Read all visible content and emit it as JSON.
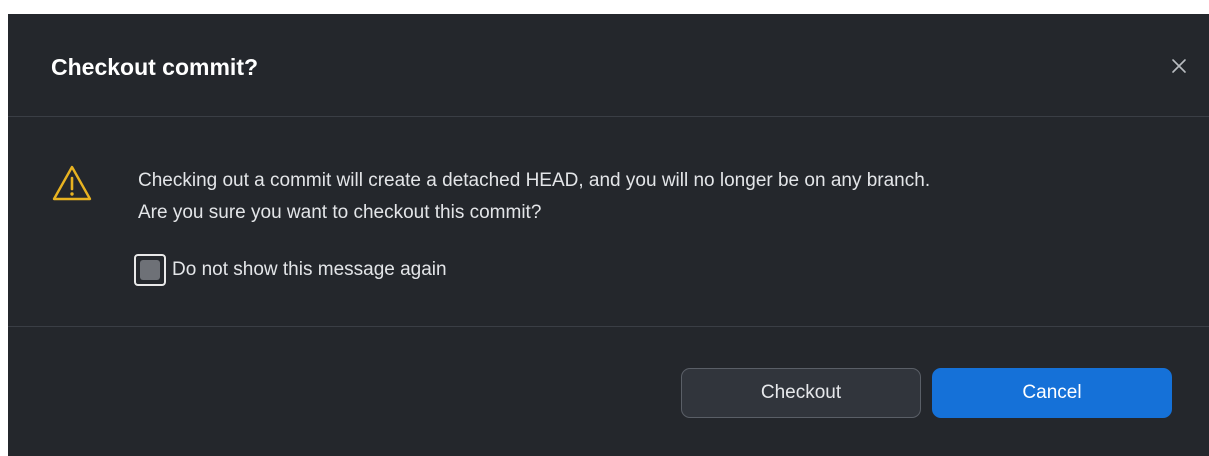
{
  "dialog": {
    "title": "Checkout commit?",
    "close_icon": "close-icon",
    "warning_icon": "warning-triangle-icon",
    "message_line1": "Checking out a commit will create a detached HEAD, and you will no longer be on any branch.",
    "message_line2": "Are you sure you want to checkout this commit?",
    "checkbox_label": "Do not show this message again",
    "checkbox_checked": false,
    "buttons": {
      "checkout": "Checkout",
      "cancel": "Cancel"
    }
  },
  "colors": {
    "background": "#24272c",
    "accent": "#1571d8",
    "warning": "#e8b321"
  }
}
